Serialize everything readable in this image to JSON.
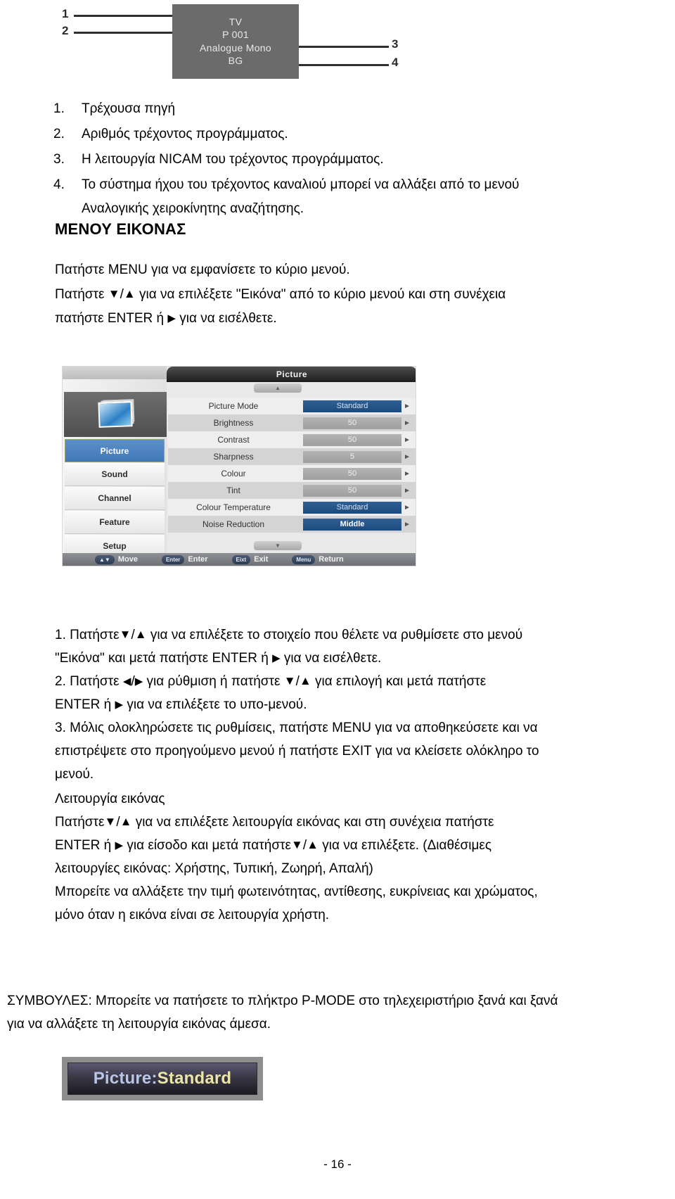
{
  "diagram": {
    "labels": {
      "one": "1",
      "two": "2",
      "three": "3",
      "four": "4"
    },
    "osd_box": {
      "line1": "TV",
      "line2": "P 001",
      "line3": "Analogue Mono",
      "line4": "BG"
    }
  },
  "numbered_list": [
    {
      "marker": "1.",
      "text": "Τρέχουσα πηγή"
    },
    {
      "marker": "2.",
      "text": "Αριθμός τρέχοντος προγράμματος."
    },
    {
      "marker": "3.",
      "text": "Η λειτουργία NICAM του τρέχοντος προγράμματος."
    },
    {
      "marker": "4.",
      "text": "Το σύστημα ήχου του τρέχοντος καναλιού μπορεί να αλλάξει από το μενού",
      "text2": "Αναλογικής χειροκίνητης αναζήτησης."
    }
  ],
  "section": {
    "heading": "ΜΕΝΟΥ ΕΙΚΟΝΑΣ",
    "menu_line": "Πατήστε MENU για να εμφανίσετε το κύριο μενού.",
    "press_prefix": "Πατήστε",
    "press_mid": "για να επιλέξετε \"Εικόνα\" από το κύριο μενού και στη συνέχεια",
    "press_line2_a": "πατήστε ENTER ή",
    "press_line2_b": "για να εισέλθετε."
  },
  "osd": {
    "title": "Picture",
    "nav": [
      {
        "label": "Picture",
        "active": true
      },
      {
        "label": "Sound",
        "active": false
      },
      {
        "label": "Channel",
        "active": false
      },
      {
        "label": "Feature",
        "active": false
      },
      {
        "label": "Setup",
        "active": false
      }
    ],
    "rows": [
      {
        "label": "Picture Mode",
        "value": "Standard",
        "style": "sel"
      },
      {
        "label": "Brightness",
        "value": "50",
        "style": "plain"
      },
      {
        "label": "Contrast",
        "value": "50",
        "style": "plain"
      },
      {
        "label": "Sharpness",
        "value": "5",
        "style": "plain"
      },
      {
        "label": "Colour",
        "value": "50",
        "style": "plain"
      },
      {
        "label": "Tint",
        "value": "50",
        "style": "plain"
      },
      {
        "label": "Colour Temperature",
        "value": "Standard",
        "style": "sel"
      },
      {
        "label": "Noise Reduction",
        "value": "Middle",
        "style": "sel-bold"
      }
    ],
    "scroll_up_icon": "scroll-up-icon",
    "scroll_down_icon": "scroll-down-icon",
    "bottom_bar": [
      {
        "key": "▲▼",
        "label": "Move"
      },
      {
        "key": "Enter",
        "label": "Enter"
      },
      {
        "key": "Eixt",
        "label": "Exit"
      },
      {
        "key": "Menu",
        "label": "Return"
      }
    ],
    "colors": {
      "selected_blue": "#2f6096",
      "nav_active": "#4179b8",
      "title_bar": "#1d1d1d"
    }
  },
  "steps": {
    "s1_a": "1. Πατήστε",
    "s1_b": "για να επιλέξετε το στοιχείο που θέλετε να ρυθμίσετε στο μενού",
    "s1_c": "\"Εικόνα\" και μετά πατήστε ENTER ή",
    "s1_d": "για να εισέλθετε.",
    "s2_a": "2. Πατήστε",
    "s2_b": "για ρύθμιση ή πατήστε",
    "s2_c": "για επιλογή και μετά πατήστε",
    "s2_d": "ENTER ή",
    "s2_e": "για να επιλέξετε το υπο-μενού.",
    "s3_a": "3. Μόλις ολοκληρώσετε τις ρυθμίσεις, πατήστε MENU για να αποθηκεύσετε και να",
    "s3_b": "επιστρέψετε στο προηγούμενο μενού ή πατήστε EXIT για να κλείσετε ολόκληρο το",
    "s3_c": "μενού."
  },
  "picture_mode": {
    "heading": "Λειτουργία εικόνας",
    "l1_a": "Πατήστε",
    "l1_b": "για να επιλέξετε λειτουργία εικόνας και στη συνέχεια πατήστε",
    "l2_a": "ENTER ή",
    "l2_b": "για είσοδο και μετά πατήστε",
    "l2_c": "για να επιλέξετε. (Διαθέσιμες",
    "l3": "λειτουργίες εικόνας: Χρήστης, Τυπική, Ζωηρή, Απαλή)",
    "l4": "Μπορείτε να αλλάξετε την τιμή φωτεινότητας, αντίθεσης, ευκρίνειας και χρώματος,",
    "l5": "μόνο όταν η εικόνα είναι σε λειτουργία χρήστη."
  },
  "tips": {
    "line1": "ΣΥΜΒΟΥΛΕΣ: Μπορείτε να πατήσετε το πλήκτρο P-MODE στο τηλεχειριστήριο ξανά και ξανά",
    "line2": "για να αλλάξετε τη λειτουργία εικόνας άμεσα."
  },
  "banner": {
    "prefix": "Picture:",
    "value": "Standard"
  },
  "page_number": "- 16 -",
  "glyphs": {
    "triangle_down": "▼",
    "triangle_up": "▲",
    "triangle_right": "▶",
    "triangle_left": "◀",
    "slash": "/"
  }
}
